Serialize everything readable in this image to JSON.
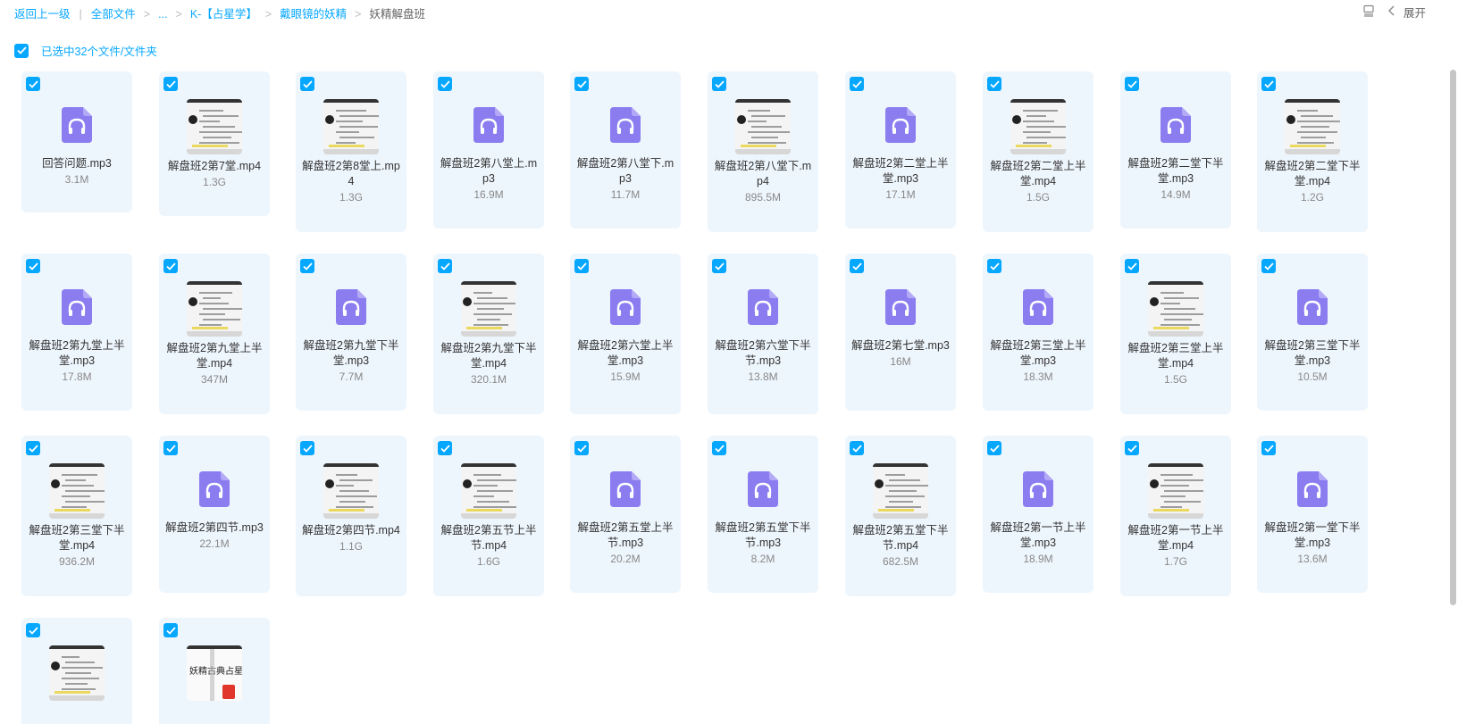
{
  "breadcrumb": {
    "back": "返回上一级",
    "all_files": "全部文件",
    "ellipsis": "...",
    "level1": "K-【占星学】",
    "level2": "戴眼镜的妖精",
    "current": "妖精解盘班"
  },
  "toolbar": {
    "expand_label": "展开"
  },
  "selection": {
    "text": "已选中32个文件/文件夹"
  },
  "colors": {
    "accent": "#06a7ff",
    "audio_icon": "#8b7cf0",
    "card_bg": "#eef6fd"
  },
  "files": [
    {
      "name": "回答问题.mp3",
      "size": "3.1M",
      "type": "audio"
    },
    {
      "name": "解盘班2第7堂.mp4",
      "size": "1.3G",
      "type": "video"
    },
    {
      "name": "解盘班2第8堂上.mp4",
      "size": "1.3G",
      "type": "video"
    },
    {
      "name": "解盘班2第八堂上.mp3",
      "size": "16.9M",
      "type": "audio"
    },
    {
      "name": "解盘班2第八堂下.mp3",
      "size": "11.7M",
      "type": "audio"
    },
    {
      "name": "解盘班2第八堂下.mp4",
      "size": "895.5M",
      "type": "video"
    },
    {
      "name": "解盘班2第二堂上半堂.mp3",
      "size": "17.1M",
      "type": "audio"
    },
    {
      "name": "解盘班2第二堂上半堂.mp4",
      "size": "1.5G",
      "type": "video"
    },
    {
      "name": "解盘班2第二堂下半堂.mp3",
      "size": "14.9M",
      "type": "audio"
    },
    {
      "name": "解盘班2第二堂下半堂.mp4",
      "size": "1.2G",
      "type": "video"
    },
    {
      "name": "解盘班2第九堂上半堂.mp3",
      "size": "17.8M",
      "type": "audio"
    },
    {
      "name": "解盘班2第九堂上半堂.mp4",
      "size": "347M",
      "type": "video"
    },
    {
      "name": "解盘班2第九堂下半堂.mp3",
      "size": "7.7M",
      "type": "audio"
    },
    {
      "name": "解盘班2第九堂下半堂.mp4",
      "size": "320.1M",
      "type": "video"
    },
    {
      "name": "解盘班2第六堂上半堂.mp3",
      "size": "15.9M",
      "type": "audio"
    },
    {
      "name": "解盘班2第六堂下半节.mp3",
      "size": "13.8M",
      "type": "audio"
    },
    {
      "name": "解盘班2第七堂.mp3",
      "size": "16M",
      "type": "audio"
    },
    {
      "name": "解盘班2第三堂上半堂.mp3",
      "size": "18.3M",
      "type": "audio"
    },
    {
      "name": "解盘班2第三堂上半堂.mp4",
      "size": "1.5G",
      "type": "video"
    },
    {
      "name": "解盘班2第三堂下半堂.mp3",
      "size": "10.5M",
      "type": "audio"
    },
    {
      "name": "解盘班2第三堂下半堂.mp4",
      "size": "936.2M",
      "type": "video"
    },
    {
      "name": "解盘班2第四节.mp3",
      "size": "22.1M",
      "type": "audio"
    },
    {
      "name": "解盘班2第四节.mp4",
      "size": "1.1G",
      "type": "video"
    },
    {
      "name": "解盘班2第五节上半节.mp4",
      "size": "1.6G",
      "type": "video"
    },
    {
      "name": "解盘班2第五堂上半节.mp3",
      "size": "20.2M",
      "type": "audio"
    },
    {
      "name": "解盘班2第五堂下半节.mp3",
      "size": "8.2M",
      "type": "audio"
    },
    {
      "name": "解盘班2第五堂下半节.mp4",
      "size": "682.5M",
      "type": "video"
    },
    {
      "name": "解盘班2第一节上半堂.mp3",
      "size": "18.9M",
      "type": "audio"
    },
    {
      "name": "解盘班2第一节上半堂.mp4",
      "size": "1.7G",
      "type": "video"
    },
    {
      "name": "解盘班2第一堂下半堂.mp3",
      "size": "13.6M",
      "type": "audio"
    },
    {
      "name": "",
      "size": "",
      "type": "video"
    },
    {
      "name": "",
      "size": "",
      "type": "pdf",
      "thumb_text": "妖精古典占星"
    }
  ]
}
